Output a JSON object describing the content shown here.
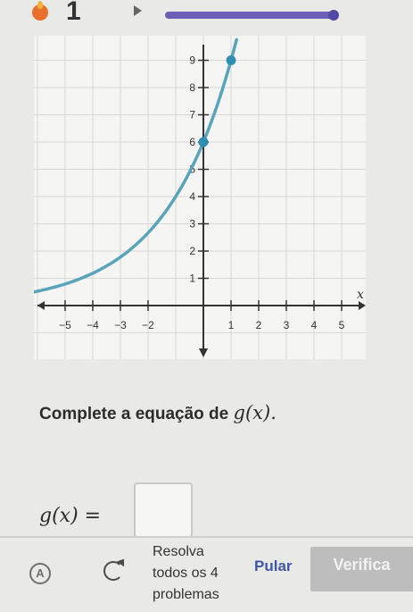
{
  "header": {
    "streak_count": "1",
    "progress_fraction": 0.97,
    "progress_color": "#6a5fb5"
  },
  "graph": {
    "x_tick_labels": [
      "−5",
      "−4",
      "−3",
      "−2",
      "1",
      "2",
      "3",
      "4",
      "5"
    ],
    "y_tick_labels": [
      "1",
      "2",
      "3",
      "4",
      "5",
      "6",
      "7",
      "8",
      "9"
    ],
    "x_axis_label": "x",
    "curve_color": "#5aa4bb",
    "point_color": "#2e8fb0",
    "points": [
      [
        0,
        6
      ],
      [
        1,
        9
      ]
    ]
  },
  "question": {
    "prompt": "Complete a equação de ",
    "math": "g(x)."
  },
  "answer": {
    "label": "g(x) =",
    "value": ""
  },
  "footer": {
    "resolve_lines": [
      "Resolva",
      "todos os 4",
      "problemas"
    ],
    "skip_label": "Pular",
    "check_label": "Verifica"
  }
}
